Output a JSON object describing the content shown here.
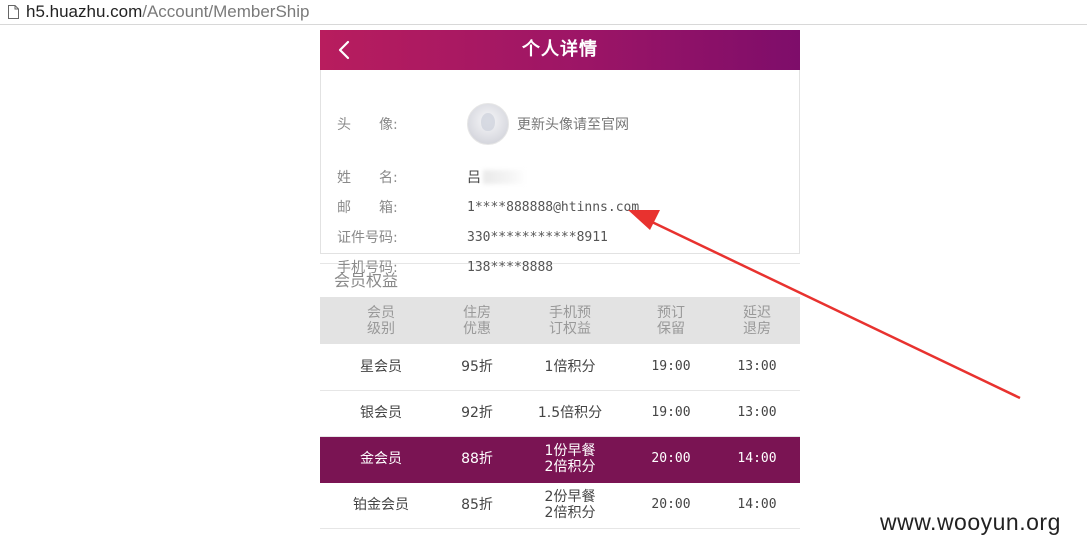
{
  "browser": {
    "url_host": "h5.huazhu.com",
    "url_path": "/Account/MemberShip"
  },
  "header": {
    "title": "个人详情"
  },
  "profile": {
    "avatar_label": "头　　像:",
    "avatar_note": "更新头像请至官网",
    "name_label": "姓　　名:",
    "name_value": "吕",
    "email_label": "邮　　箱:",
    "email_value": "1****888888@htinns.com",
    "id_label": "证件号码:",
    "id_value": "330***********8911",
    "phone_label": "手机号码:",
    "phone_value": "138****8888"
  },
  "benefits": {
    "title": "会员权益",
    "columns": [
      [
        "会员",
        "级别"
      ],
      [
        "住房",
        "优惠"
      ],
      [
        "手机预",
        "订权益"
      ],
      [
        "预订",
        "保留"
      ],
      [
        "延迟",
        "退房"
      ]
    ],
    "rows": [
      {
        "level": "星会员",
        "discount": "95折",
        "mobile": [
          "1倍积分"
        ],
        "hold": "19:00",
        "checkout": "13:00"
      },
      {
        "level": "银会员",
        "discount": "92折",
        "mobile": [
          "1.5倍积分"
        ],
        "hold": "19:00",
        "checkout": "13:00"
      },
      {
        "level": "金会员",
        "discount": "88折",
        "mobile": [
          "1份早餐",
          "2倍积分"
        ],
        "hold": "20:00",
        "checkout": "14:00"
      },
      {
        "level": "铂金会员",
        "discount": "85折",
        "mobile": [
          "2份早餐",
          "2倍积分"
        ],
        "hold": "20:00",
        "checkout": "14:00"
      }
    ]
  },
  "watermark": "www.wooyun.org",
  "colors": {
    "header_start": "#b81d5e",
    "header_end": "#7e0d6a",
    "highlight_row": "#7a1453",
    "arrow": "#e8322f"
  }
}
